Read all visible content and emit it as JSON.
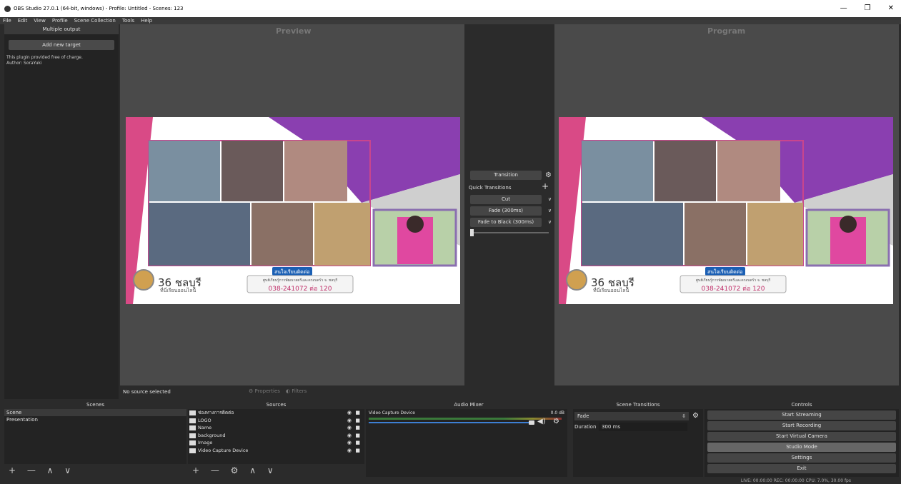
{
  "window": {
    "title": "OBS Studio 27.0.1 (64-bit, windows) - Profile: Untitled - Scenes: 123",
    "minimize": "—",
    "maximize": "❐",
    "close": "✕"
  },
  "menu": [
    "File",
    "Edit",
    "View",
    "Profile",
    "Scene Collection",
    "Tools",
    "Help"
  ],
  "multiple_output": {
    "title": "Multiple output",
    "add_button": "Add new target",
    "info_line1": "This plugin provided free of charge.",
    "info_line2": "Author: SoraYuki"
  },
  "preview": {
    "title": "Preview",
    "program_title": "Program"
  },
  "slide": {
    "number": "36 ชลบุรี",
    "subtitle": "ที่นี่เรียนออนไลน์",
    "contact_title": "สนใจเรียนติดต่อ",
    "contact_line": "ศูนย์เรียนรู้การพัฒนาสตรีและครอบครัว จ. ชลบุรี",
    "phone": "038-241072 ต่อ 120",
    "colors": {
      "pink": "#d94a86",
      "purple": "#8a3fb0"
    }
  },
  "transitions_dock": {
    "transition_button": "Transition",
    "quick_label": "Quick Transitions",
    "items": [
      "Cut",
      "Fade (300ms)",
      "Fade to Black (300ms)"
    ]
  },
  "source_bar": {
    "status": "No source selected",
    "properties": "Properties",
    "filters": "Filters"
  },
  "scenes": {
    "title": "Scenes",
    "items": [
      "Scene",
      "Presentation"
    ],
    "tools": "+ — ∧ ∨"
  },
  "sources": {
    "title": "Sources",
    "items": [
      "ช่องทางการติดต่อ",
      "LOGO",
      "Name",
      "background",
      "Image",
      "Video Capture Device"
    ],
    "tools": "+ — ⚙ ∧ ∨"
  },
  "mixer": {
    "title": "Audio Mixer",
    "channel": "Video Capture Device",
    "db": "0.0 dB",
    "scale": [
      "-60",
      "-55",
      "-50",
      "-45",
      "-40",
      "-35",
      "-30",
      "-25",
      "-20",
      "-15",
      "-10",
      "-5",
      "0"
    ]
  },
  "scene_transitions": {
    "title": "Scene Transitions",
    "selected": "Fade",
    "duration_label": "Duration",
    "duration_value": "300 ms"
  },
  "controls": {
    "title": "Controls",
    "buttons": [
      "Start Streaming",
      "Start Recording",
      "Start Virtual Camera",
      "Studio Mode",
      "Settings",
      "Exit"
    ]
  },
  "status": {
    "live": "LIVE: 00:00:00",
    "rec": "REC: 00:00:00",
    "cpu": "CPU: 7.0%, 30.00 fps"
  }
}
